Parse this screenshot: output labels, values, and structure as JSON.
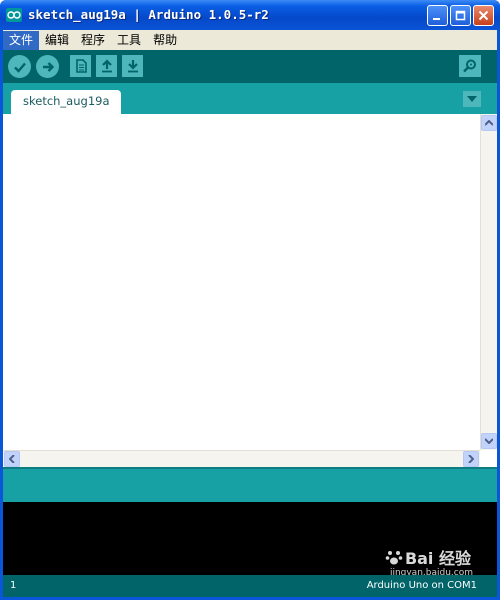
{
  "window": {
    "title": "sketch_aug19a | Arduino 1.0.5-r2"
  },
  "menu": {
    "items": [
      {
        "label": "文件"
      },
      {
        "label": "编辑"
      },
      {
        "label": "程序"
      },
      {
        "label": "工具"
      },
      {
        "label": "帮助"
      }
    ]
  },
  "toolbar": {
    "buttons": [
      "verify-icon",
      "upload-icon",
      "new-icon",
      "open-icon",
      "save-icon",
      "serial-monitor-icon"
    ]
  },
  "tabs": {
    "items": [
      {
        "label": "sketch_aug19a"
      }
    ]
  },
  "editor": {
    "content": ""
  },
  "status": {
    "line_number": "1",
    "board": "Arduino Uno on COM1"
  },
  "watermark": {
    "brand": "Bai 经验",
    "url": "jingyan.baidu.com"
  },
  "colors": {
    "toolbar": "#006468",
    "tabstrip": "#17a1a5",
    "button": "#4db7bb",
    "console": "#000000"
  }
}
